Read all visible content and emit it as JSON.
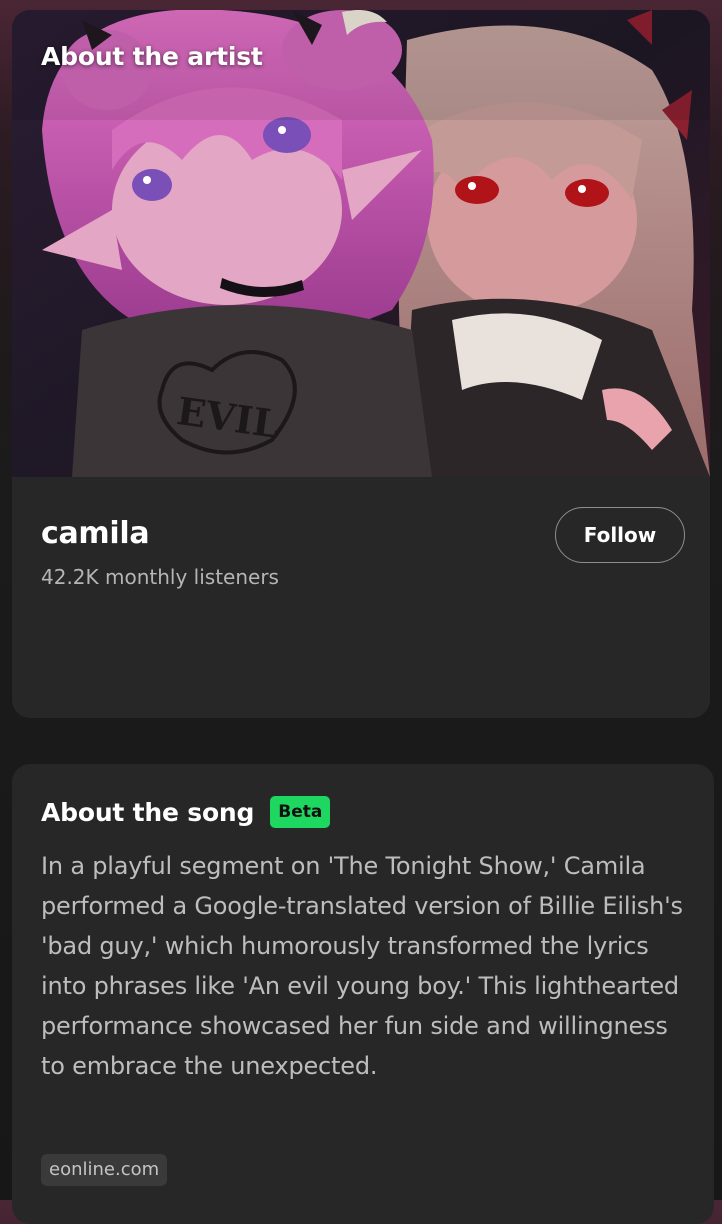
{
  "artist_section": {
    "heading": "About the artist",
    "artist_name": "camila",
    "monthly_listeners": "42.2K monthly listeners",
    "follow_label": "Follow"
  },
  "song_section": {
    "heading": "About the song",
    "badge": "Beta",
    "description": "In a playful segment on 'The Tonight Show,' Camila performed a Google-translated version of Billie Eilish's 'bad guy,' which humorously transformed the lyrics into phrases like 'An evil young boy.' This lighthearted performance showcased her fun side and willingness to embrace the unexpected.",
    "source": "eonline.com"
  },
  "artwork": {
    "shirt_text": "EVIL"
  },
  "colors": {
    "card_background": "#272727",
    "accent_green": "#1ed760",
    "secondary_text": "#b5b5b5"
  }
}
